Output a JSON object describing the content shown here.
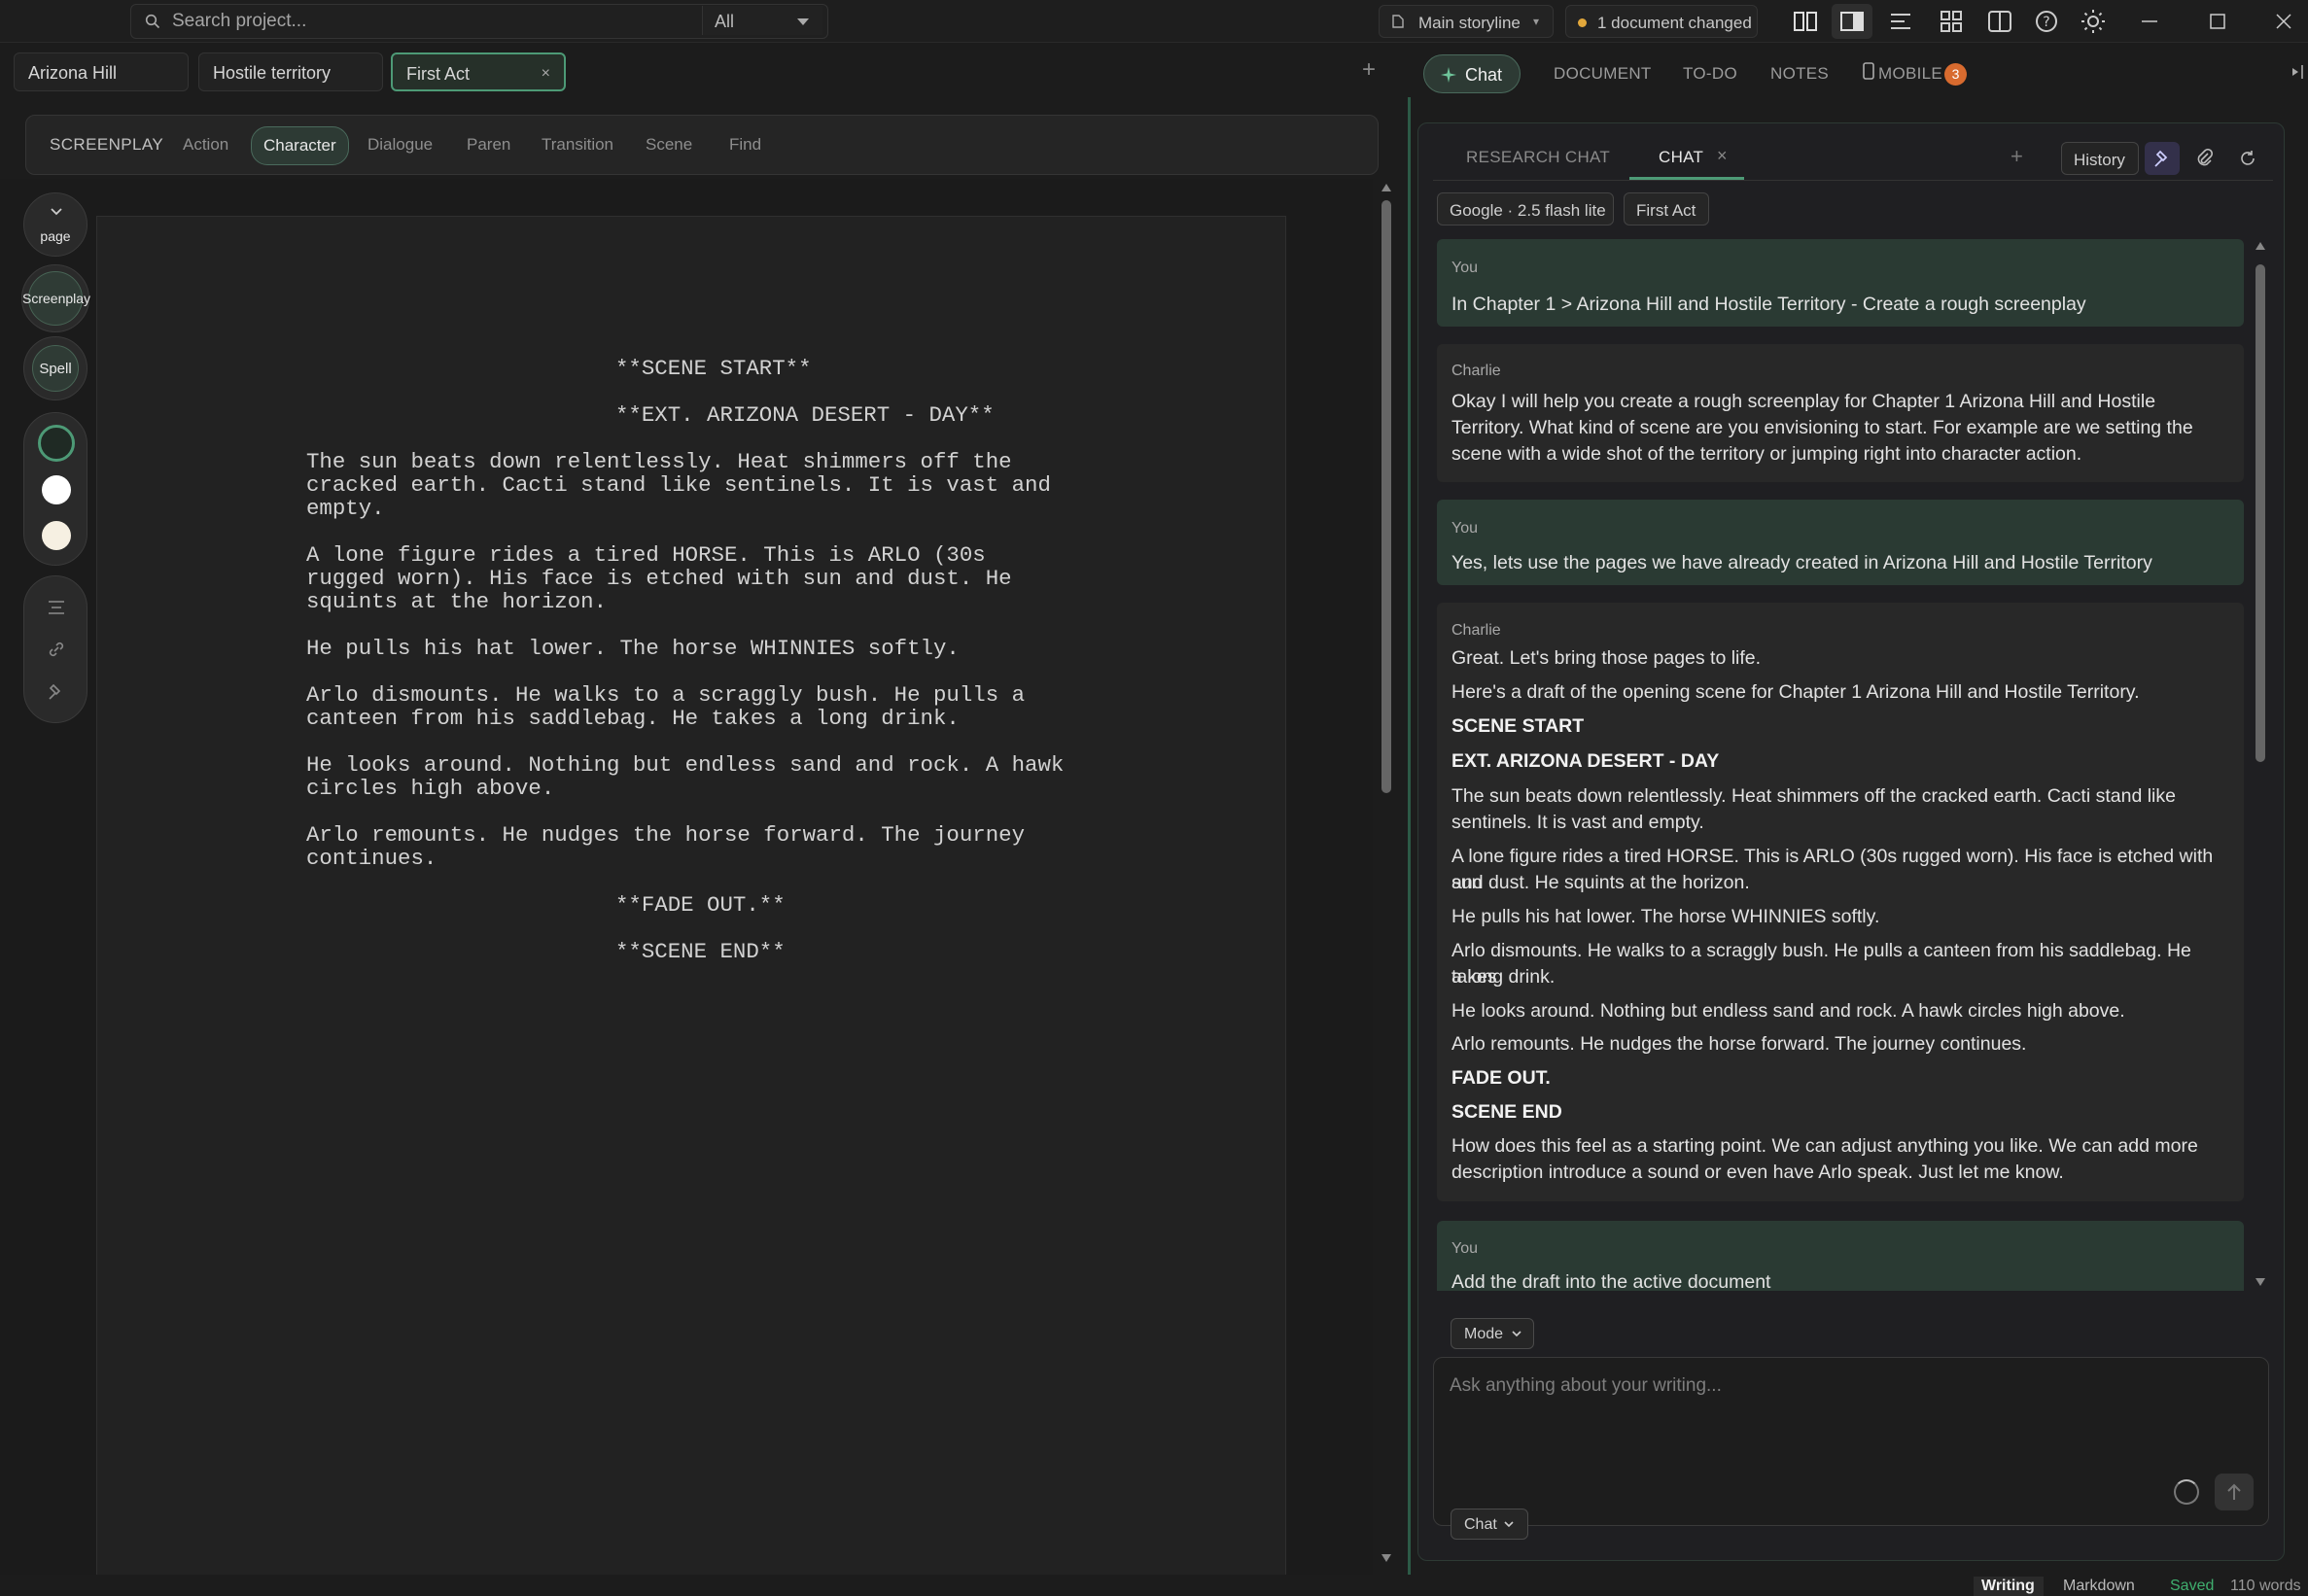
{
  "topbar": {
    "search_placeholder": "Search project...",
    "scope_value": "All",
    "storyline_label": "Main storyline",
    "changed_label": "1 document changed"
  },
  "doc_tabs": [
    {
      "label": "Arizona Hill"
    },
    {
      "label": "Hostile territory"
    },
    {
      "label": "First Act",
      "active": true,
      "close": "×"
    }
  ],
  "add_tab_symbol": "+",
  "screenplay_toolbar": {
    "title": "SCREENPLAY",
    "items": [
      "Action",
      "Character",
      "Dialogue",
      "Paren",
      "Transition",
      "Scene",
      "Find"
    ],
    "active": "Character"
  },
  "left_rail": {
    "page_label": "page",
    "screenplay_label": "Screenplay",
    "spell_label": "Spell"
  },
  "screenplay_lines": [
    {
      "text": "**SCENE START**",
      "indent": "center"
    },
    {
      "text": "**EXT. ARIZONA DESERT - DAY**",
      "indent": "center"
    },
    {
      "text": "The sun beats down relentlessly. Heat shimmers off the",
      "indent": "action"
    },
    {
      "text": "cracked earth. Cacti stand like sentinels. It is vast and",
      "indent": "action"
    },
    {
      "text": "empty.",
      "indent": "action"
    },
    {
      "text": "A lone figure rides a tired HORSE. This is ARLO (30s",
      "indent": "action"
    },
    {
      "text": "rugged worn). His face is etched with sun and dust. He",
      "indent": "action"
    },
    {
      "text": "squints at the horizon.",
      "indent": "action"
    },
    {
      "text": "He pulls his hat lower. The horse WHINNIES softly.",
      "indent": "action"
    },
    {
      "text": "Arlo dismounts. He walks to a scraggly bush. He pulls a",
      "indent": "action"
    },
    {
      "text": "canteen from his saddlebag. He takes a long drink.",
      "indent": "action"
    },
    {
      "text": "He looks around. Nothing but endless sand and rock. A hawk",
      "indent": "action"
    },
    {
      "text": "circles high above.",
      "indent": "action"
    },
    {
      "text": "Arlo remounts. He nudges the horse forward. The journey",
      "indent": "action"
    },
    {
      "text": "continues.",
      "indent": "action"
    },
    {
      "text": "**FADE OUT.**",
      "indent": "center"
    },
    {
      "text": "**SCENE END**",
      "indent": "center"
    }
  ],
  "right_tabs": {
    "chat": "Chat",
    "document": "DOCUMENT",
    "todo": "TO-DO",
    "notes": "NOTES",
    "mobile": "MOBILE",
    "mobile_badge": "3"
  },
  "chat_subtabs": {
    "research": "RESEARCH CHAT",
    "chat": "CHAT",
    "close": "×",
    "add": "+",
    "history": "History"
  },
  "chips": {
    "model": "Google · 2.5 flash lite",
    "context": "First Act"
  },
  "messages": {
    "m1_who": "You",
    "m1_text": "In Chapter 1 > Arizona Hill and Hostile Territory - Create a rough screenplay",
    "m2_who": "Charlie",
    "m2_l1": "Okay I will help you create a rough screenplay for Chapter 1 Arizona Hill and Hostile",
    "m2_l2": "Territory. What kind of scene are you envisioning to start. For example are we setting the",
    "m2_l3": "scene with a wide shot of the territory or jumping right into character action.",
    "m3_who": "You",
    "m3_text": "Yes, lets use the pages we have already created in Arizona Hill and Hostile Territory",
    "m4_who": "Charlie",
    "m4_p1": "Great. Let's bring those pages to life.",
    "m4_p2": "Here's a draft of the opening scene for Chapter 1 Arizona Hill and Hostile Territory.",
    "m4_p3": "SCENE START",
    "m4_p4": "EXT. ARIZONA DESERT - DAY",
    "m4_p5a": "The sun beats down relentlessly. Heat shimmers off the cracked earth. Cacti stand like",
    "m4_p5b": "sentinels. It is vast and empty.",
    "m4_p6a": "A lone figure rides a tired HORSE. This is ARLO (30s rugged worn). His face is etched with sun",
    "m4_p6b": "and dust. He squints at the horizon.",
    "m4_p7": "He pulls his hat lower. The horse WHINNIES softly.",
    "m4_p8a": "Arlo dismounts. He walks to a scraggly bush. He pulls a canteen from his saddlebag. He takes",
    "m4_p8b": "a long drink.",
    "m4_p9": "He looks around. Nothing but endless sand and rock. A hawk circles high above.",
    "m4_p10": "Arlo remounts. He nudges the horse forward. The journey continues.",
    "m4_p11": "FADE OUT.",
    "m4_p12": "SCENE END",
    "m4_p13a": "How does this feel as a starting point. We can adjust anything you like. We can add more",
    "m4_p13b": "description introduce a sound or even have Arlo speak. Just let me know.",
    "m5_who": "You",
    "m5_text": "Add the draft into the active document"
  },
  "composer": {
    "mode_label": "Mode",
    "placeholder": "Ask anything about your writing...",
    "chat_mode_label": "Chat"
  },
  "statusbar": {
    "writing": "Writing",
    "markdown": "Markdown",
    "saved": "Saved",
    "words": "110 words"
  },
  "colors": {
    "accent": "#4d9a76",
    "badge": "#d86b2f",
    "changed_dot": "#e2a73b",
    "saved": "#3fae6e"
  }
}
